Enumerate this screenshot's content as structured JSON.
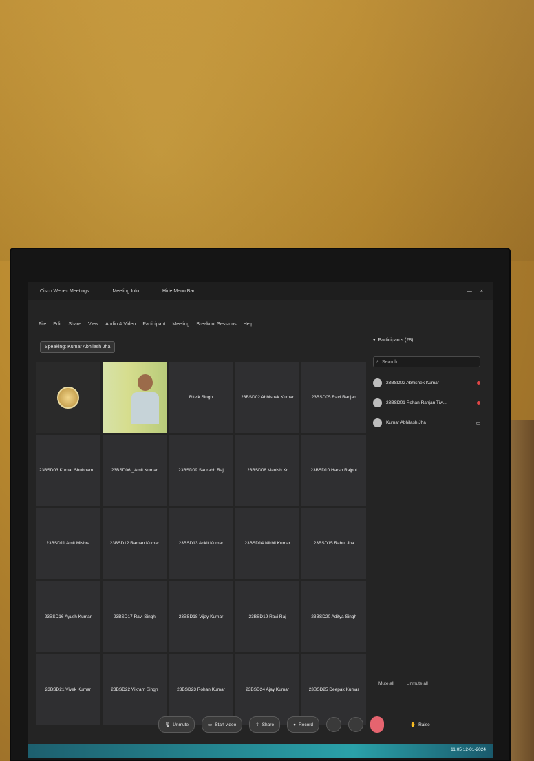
{
  "app": {
    "title": "Cisco Webex Meetings",
    "meeting_info": "Meeting Info",
    "hide_menu": "Hide Menu Bar"
  },
  "menus": [
    "File",
    "Edit",
    "Share",
    "View",
    "Audio & Video",
    "Participant",
    "Meeting",
    "Breakout Sessions",
    "Help"
  ],
  "speaking": "Speaking: Kumar Abhilash Jha",
  "tiles": [
    {
      "kind": "logo",
      "label": ""
    },
    {
      "kind": "video",
      "label": ""
    },
    {
      "kind": "name",
      "label": "Ritvik Singh"
    },
    {
      "kind": "name",
      "label": "23BSD02 Abhishek Kumar"
    },
    {
      "kind": "name",
      "label": "23BSD05 Ravi Ranjan"
    },
    {
      "kind": "name",
      "label": "23BSD03 Kumar Shubham..."
    },
    {
      "kind": "name",
      "label": "23BSD06 _Amit Kumar"
    },
    {
      "kind": "name",
      "label": "23BSD09 Saurabh Raj"
    },
    {
      "kind": "name",
      "label": "23BSD08 Manish Kr"
    },
    {
      "kind": "name",
      "label": "23BSD10 Harsh Rajput"
    },
    {
      "kind": "name",
      "label": "23BSD11 Amit Mishra"
    },
    {
      "kind": "name",
      "label": "23BSD12 Raman Kumar"
    },
    {
      "kind": "name",
      "label": "23BSD13 Ankit Kumar"
    },
    {
      "kind": "name",
      "label": "23BSD14 Nikhil Kumar"
    },
    {
      "kind": "name",
      "label": "23BSD15 Rahul Jha"
    },
    {
      "kind": "name",
      "label": "23BSD16 Ayush Kumar"
    },
    {
      "kind": "name",
      "label": "23BSD17 Ravi Singh"
    },
    {
      "kind": "name",
      "label": "23BSD18 Vijay Kumar"
    },
    {
      "kind": "name",
      "label": "23BSD19 Ravi Raj"
    },
    {
      "kind": "name",
      "label": "23BSD20 Aditya Singh"
    },
    {
      "kind": "name",
      "label": "23BSD21 Vivek Kumar"
    },
    {
      "kind": "name",
      "label": "23BSD22 Vikram Singh"
    },
    {
      "kind": "name",
      "label": "23BSD23 Rohan Kumar"
    },
    {
      "kind": "name",
      "label": "23BSD24 Ajay Kumar"
    },
    {
      "kind": "name",
      "label": "23BSD25 Deepak Kumar"
    }
  ],
  "participants": {
    "title": "Participants (28)",
    "search_placeholder": "Search",
    "list": [
      {
        "name": "23BSD02 Abhishek Kumar"
      },
      {
        "name": "23BSD01 Rohan Ranjan Tiw..."
      },
      {
        "name": "Kumar Abhilash Jha"
      }
    ],
    "footer": [
      "Mute all",
      "Unmute all"
    ]
  },
  "toolbar": {
    "unmute": "Unmute",
    "start_video": "Start video",
    "share": "Share",
    "record": "Record",
    "raise": "Raise"
  },
  "taskbar": {
    "clock_line1": "11:05",
    "clock_line2": "12-01-2024"
  },
  "colors": {
    "wall": "#b9892f",
    "screen_bg": "#242424",
    "leave_button": "#e5646f",
    "taskbar": "#2aa1a9"
  }
}
